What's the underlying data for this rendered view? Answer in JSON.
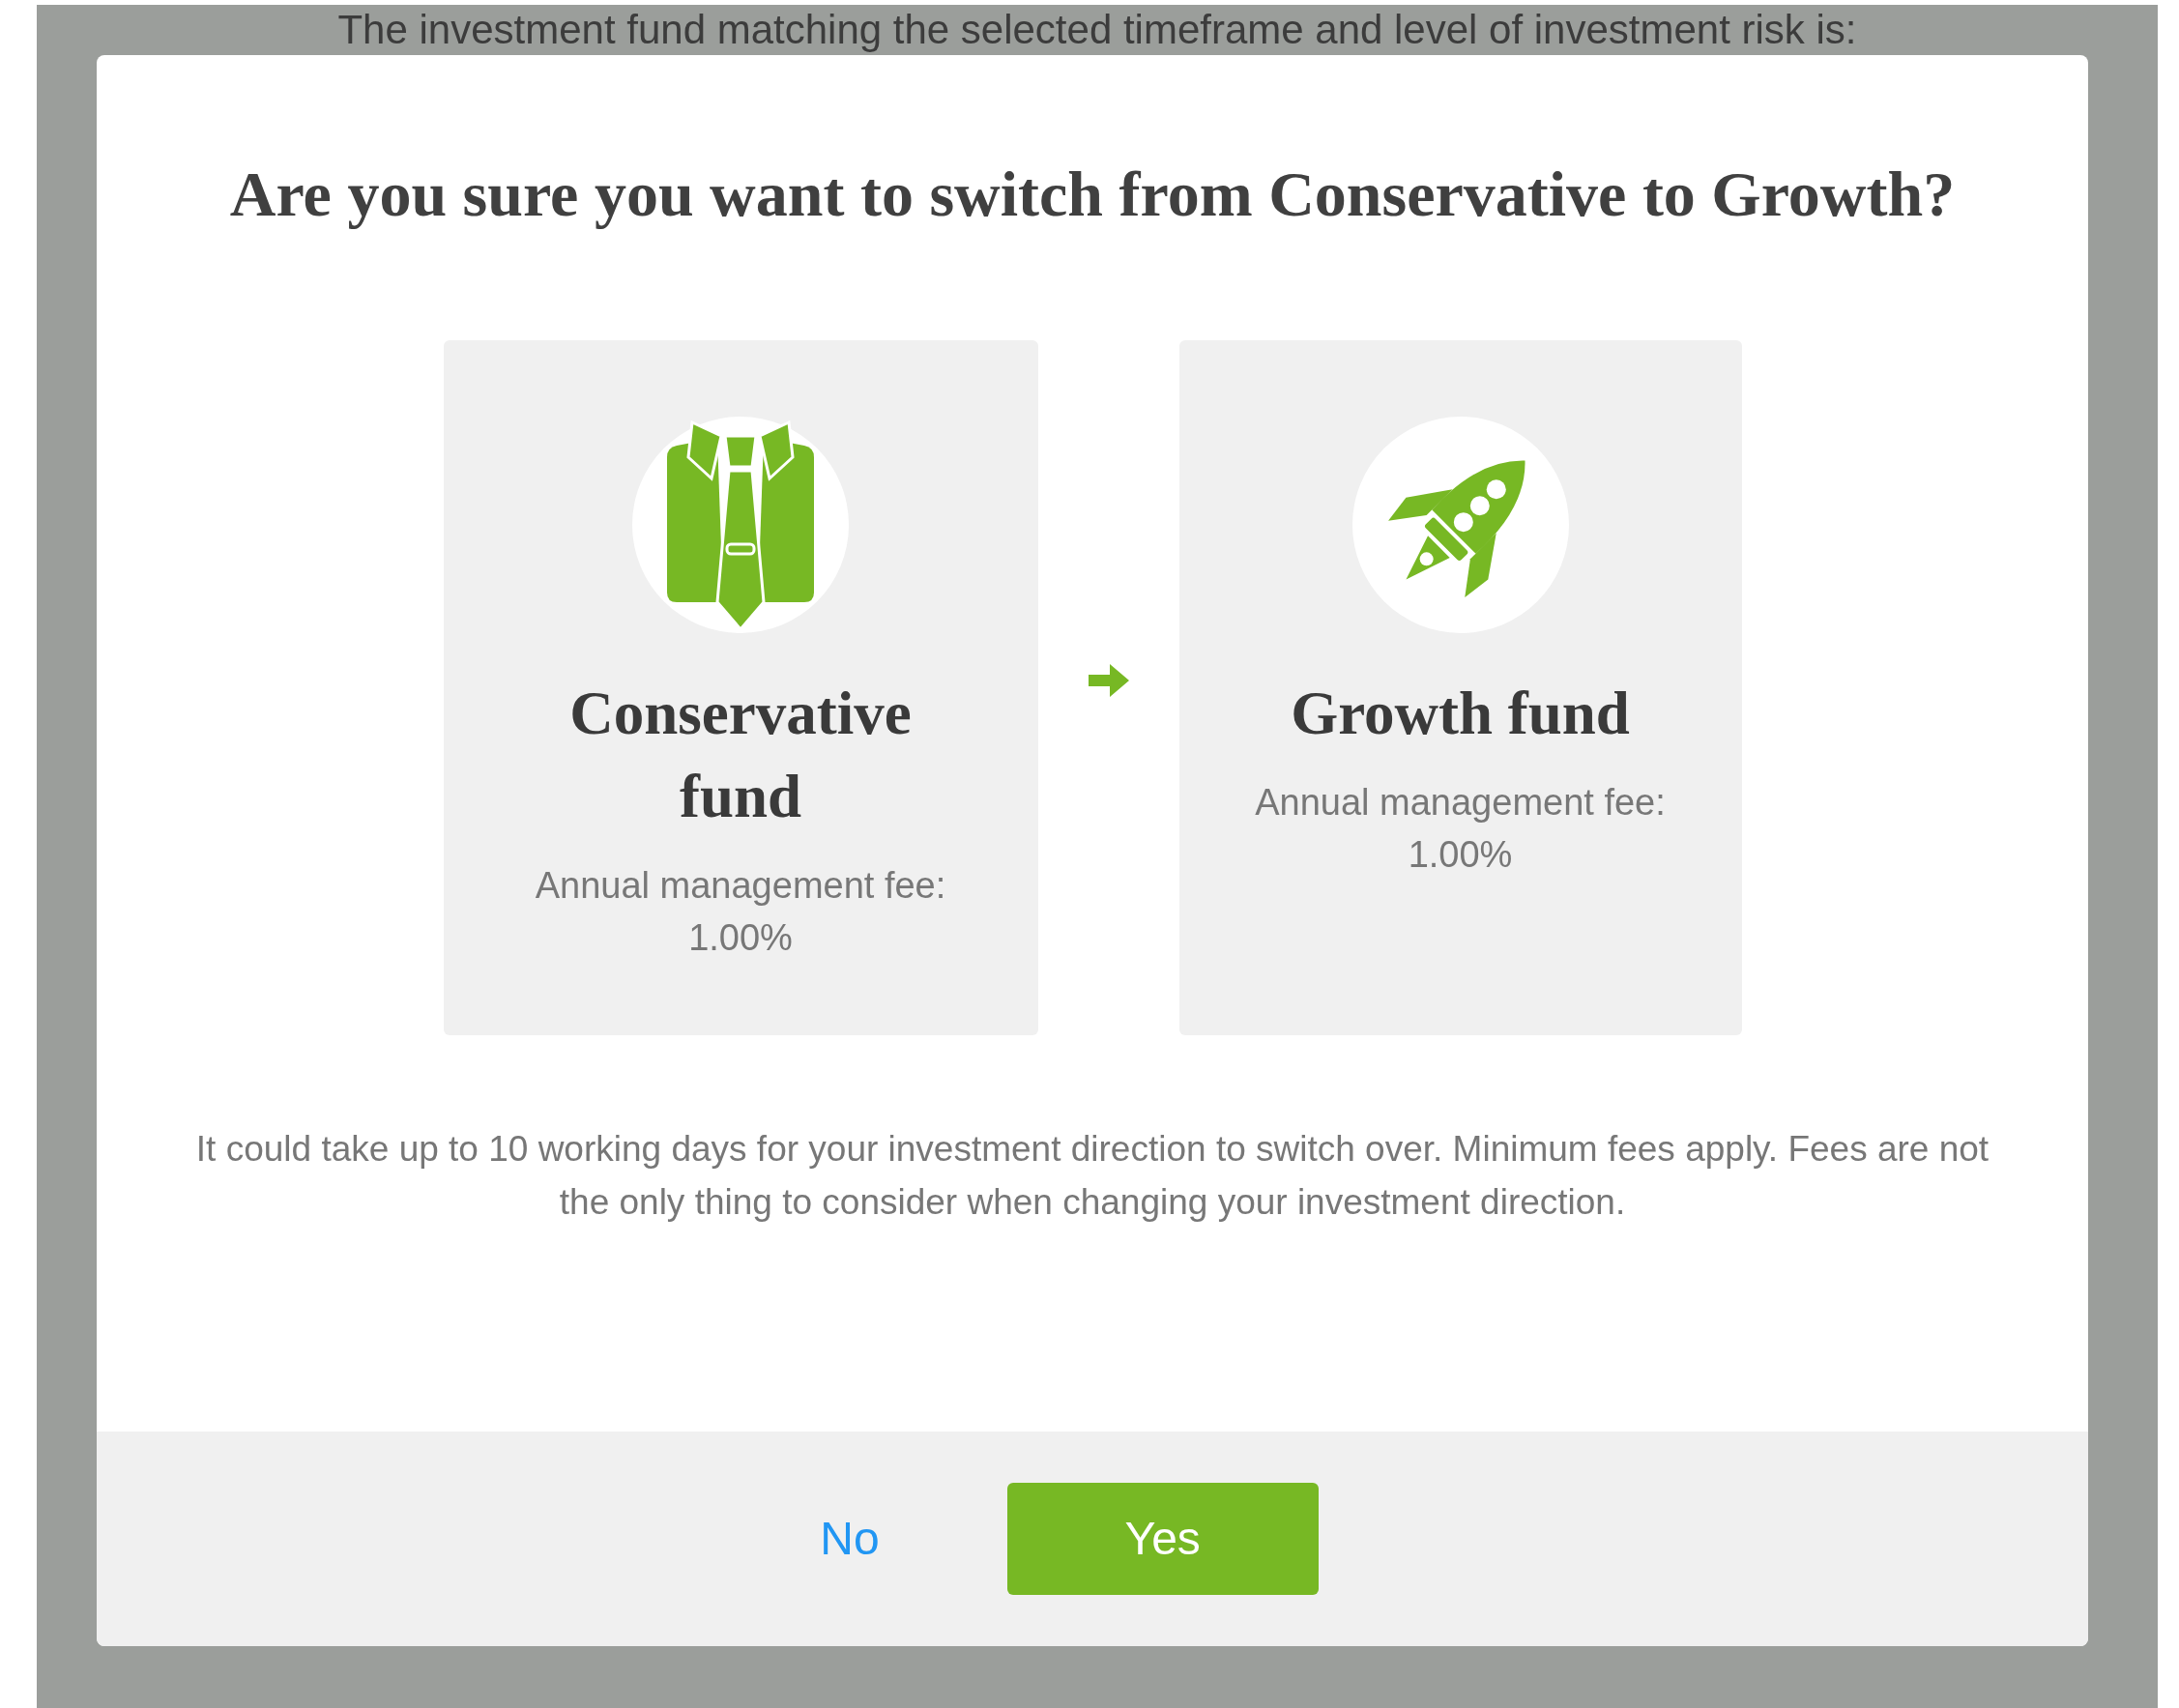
{
  "background_text": "The investment fund matching the selected timeframe and level of investment risk is:",
  "dialog": {
    "title": "Are you sure you want to switch from Conservative to Growth?",
    "funds": [
      {
        "kind": "shirt",
        "name": "Conservative fund",
        "fee_label": "Annual management fee:",
        "fee": "1.00%"
      },
      {
        "kind": "rocket",
        "name": "Growth fund",
        "fee_label": "Annual management fee:",
        "fee": "1.00%"
      }
    ],
    "note": "It could take up to 10 working days for your investment direction to switch over. Minimum fees apply. Fees are not the only thing to consider when changing your investment direction.",
    "buttons": [
      {
        "kind": "link",
        "label": "No"
      },
      {
        "kind": "primary",
        "label": "Yes"
      }
    ]
  }
}
